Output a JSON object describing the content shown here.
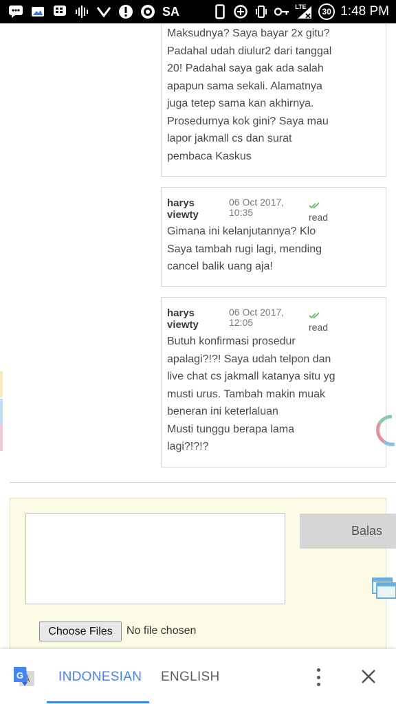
{
  "status_bar": {
    "carrier_label": "SA",
    "network_label": "LTE",
    "notification_badge": "30",
    "time": "1:48 PM"
  },
  "messages": [
    {
      "body_lines": [
        "Maksudnya? Saya bayar 2x gitu?",
        "Padahal udah diulur2 dari tanggal",
        "20! Padahal saya gak ada salah",
        "apapun sama sekali. Alamatnya",
        "juga tetep sama kan akhirnya.",
        "Prosedurnya kok gini? Saya mau",
        "lapor jakmall cs dan surat",
        "pembaca Kaskus"
      ]
    },
    {
      "author_line1": "harys",
      "author_line2": "viewty",
      "date_line1": "06 Oct 2017,",
      "date_line2": "10:35",
      "status": "read",
      "body_lines": [
        "Gimana ini kelanjutannya? Klo",
        "Saya tambah rugi lagi, mending",
        "cancel balik uang aja!"
      ]
    },
    {
      "author_line1": "harys",
      "author_line2": "viewty",
      "date_line1": "06 Oct 2017,",
      "date_line2": "12:05",
      "status": "read",
      "body_lines": [
        "Butuh konfirmasi prosedur",
        "apalagi?!?! Saya udah telpon dan",
        "live chat cs jakmall katanya situ yg",
        "musti urus. Tambah makin muak",
        "beneran ini keterlaluan",
        "Musti tunggu berapa lama",
        "lagi?!?!?"
      ]
    }
  ],
  "reply_form": {
    "reply_value": "",
    "submit_label": "Balas",
    "file_button_label": "Choose Files",
    "file_status": "No file chosen"
  },
  "translate_bar": {
    "source_language": "INDONESIAN",
    "target_language": "ENGLISH",
    "accent_color": "#4285f4"
  },
  "colors": {
    "read_check": "#5cb85c",
    "reply_box_bg": "#fbfbe6",
    "button_bg": "#d6d6d6"
  }
}
